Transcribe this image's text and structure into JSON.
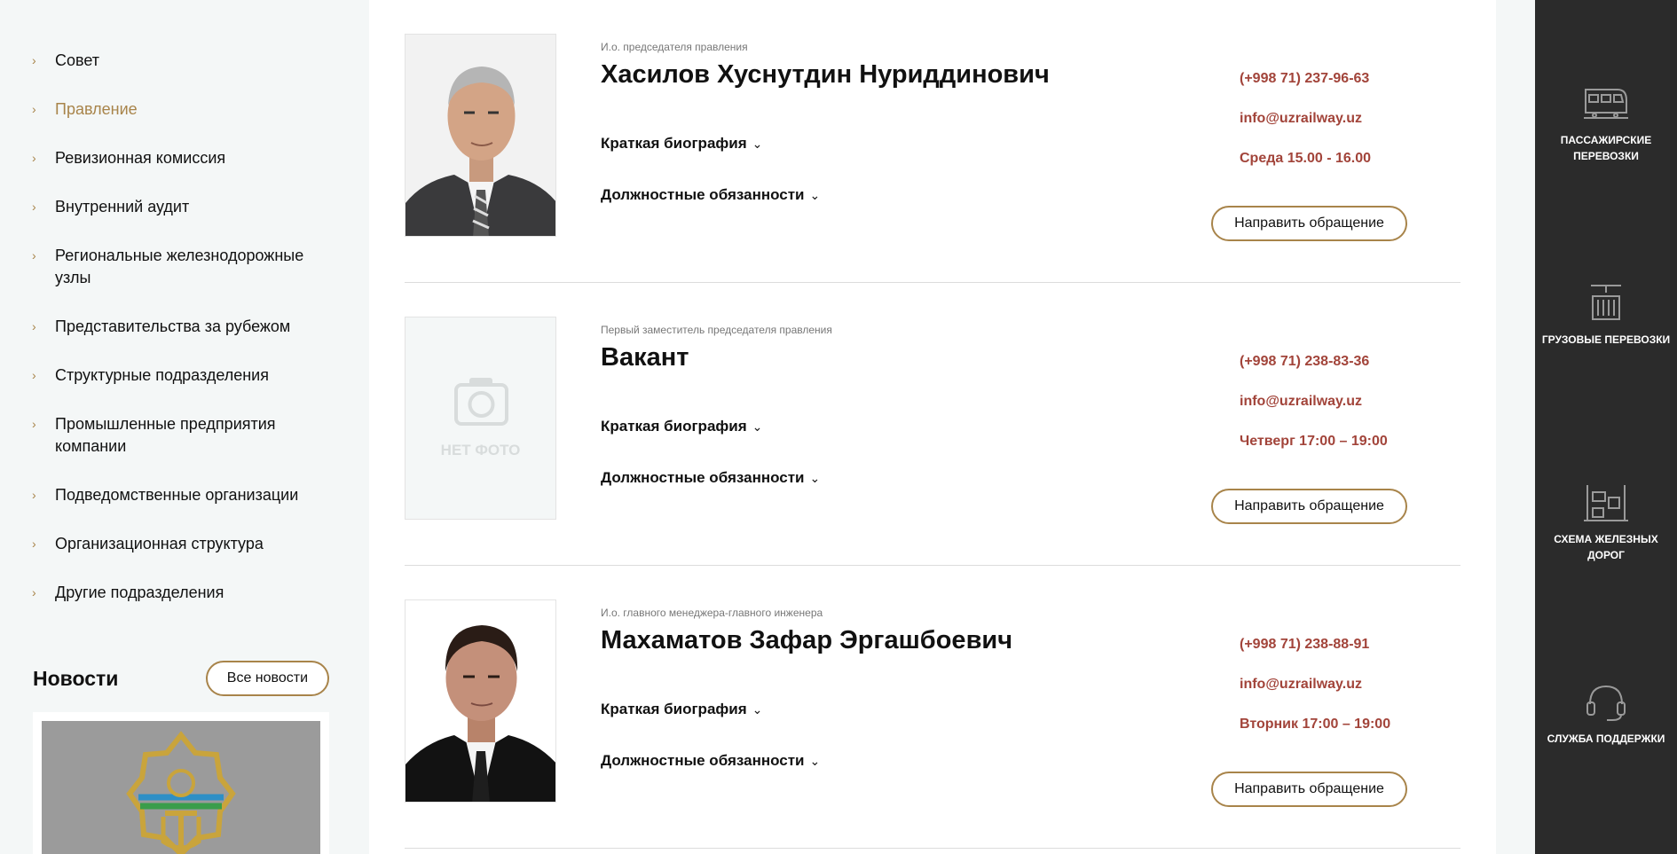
{
  "sidebar": {
    "menu": [
      {
        "label": "Совет",
        "active": false
      },
      {
        "label": "Правление",
        "active": true
      },
      {
        "label": "Ревизионная комиссия",
        "active": false
      },
      {
        "label": "Внутренний аудит",
        "active": false
      },
      {
        "label": "Региональные железнодорожные узлы",
        "active": false
      },
      {
        "label": "Представительства за рубежом",
        "active": false
      },
      {
        "label": "Структурные подразделения",
        "active": false
      },
      {
        "label": "Промышленные предприятия компании",
        "active": false
      },
      {
        "label": "Подведомственные организации",
        "active": false
      },
      {
        "label": "Организационная структура",
        "active": false
      },
      {
        "label": "Другие подразделения",
        "active": false
      }
    ],
    "news": {
      "title": "Новости",
      "all_label": "Все новости"
    }
  },
  "people": [
    {
      "position": "И.о. председателя правления",
      "name": "Хасилов Хуснутдин Нуриддинович",
      "bio_label": "Краткая биография",
      "duties_label": "Должностные обязанности",
      "phone": "(+998 71) 237-96-63",
      "email": "info@uzrailway.uz",
      "hours": "Среда 15.00 - 16.00",
      "contact_label": "Направить обращение",
      "has_photo": true
    },
    {
      "position": "Первый заместитель председателя правления",
      "name": "Вакант",
      "bio_label": "Краткая биография",
      "duties_label": "Должностные обязанности",
      "phone": "(+998 71) 238-83-36",
      "email": "info@uzrailway.uz",
      "hours": "Четверг 17:00 – 19:00",
      "contact_label": "Направить обращение",
      "has_photo": false,
      "no_photo_label": "НЕТ ФОТО"
    },
    {
      "position": "И.о. главного менеджера-главного инженера",
      "name": "Махаматов Зафар Эргашбоевич",
      "bio_label": "Краткая биография",
      "duties_label": "Должностные обязанности",
      "phone": "(+998 71) 238-88-91",
      "email": "info@uzrailway.uz",
      "hours": "Вторник 17:00 – 19:00",
      "contact_label": "Направить обращение",
      "has_photo": true
    }
  ],
  "rightbar": [
    {
      "label": "Пассажирские перевозки",
      "icon": "train-icon"
    },
    {
      "label": "Грузовые перевозки",
      "icon": "cargo-container-icon"
    },
    {
      "label": "Схема железных дорог",
      "icon": "railway-map-icon"
    },
    {
      "label": "Служба поддержки",
      "icon": "headset-icon"
    }
  ],
  "colors": {
    "accent": "#a8844a",
    "contact": "#a2443a",
    "dark_panel": "#2b2b2b",
    "sidebar_bg": "#f4f7f7"
  }
}
